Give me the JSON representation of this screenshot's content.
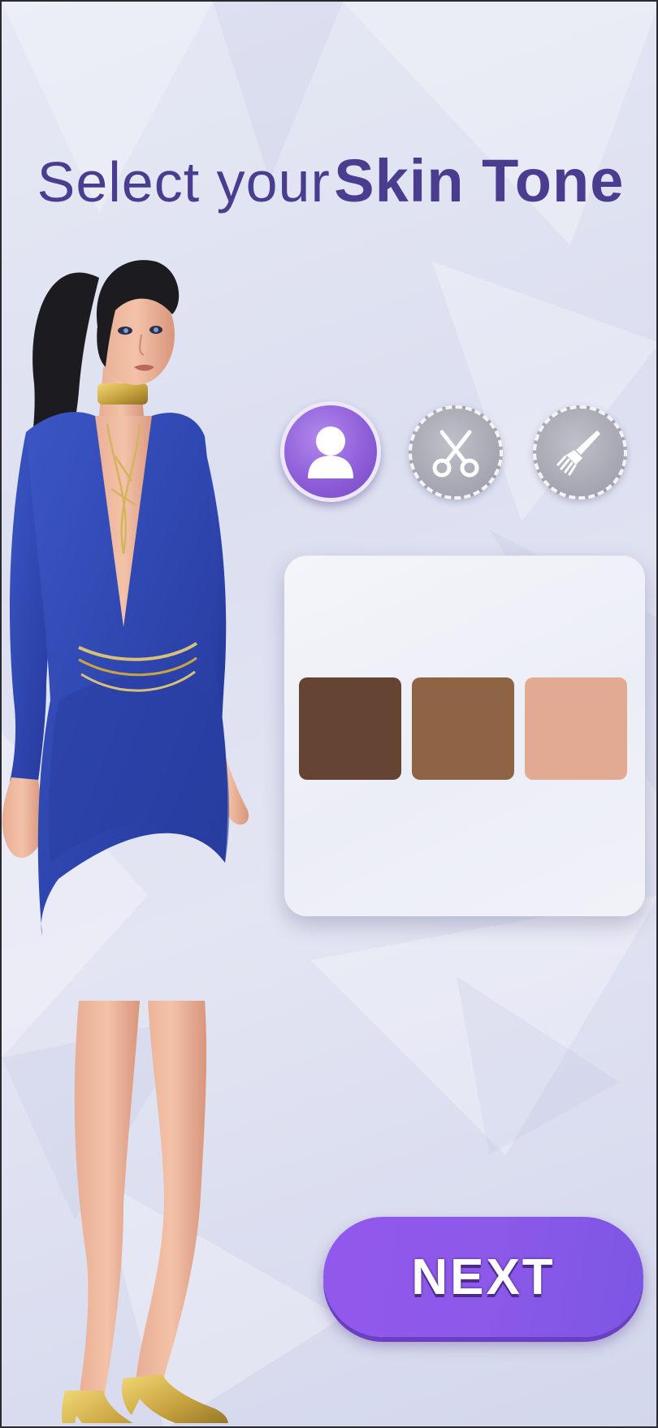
{
  "title": {
    "prefix": "Select your",
    "emphasis": "Skin Tone"
  },
  "tabs": [
    {
      "icon": "person-icon",
      "active": true
    },
    {
      "icon": "scissors-icon",
      "active": false
    },
    {
      "icon": "brush-icon",
      "active": false
    }
  ],
  "skin_tones": [
    {
      "color": "#654434"
    },
    {
      "color": "#8f6444"
    },
    {
      "color": "#e2aa92"
    }
  ],
  "next_button": {
    "label": "NEXT"
  },
  "colors": {
    "title": "#4a3d8f",
    "accent": "#8d59e9",
    "dress": "#2f47b0",
    "hair": "#1c1c20",
    "gold": "#c9a541"
  }
}
